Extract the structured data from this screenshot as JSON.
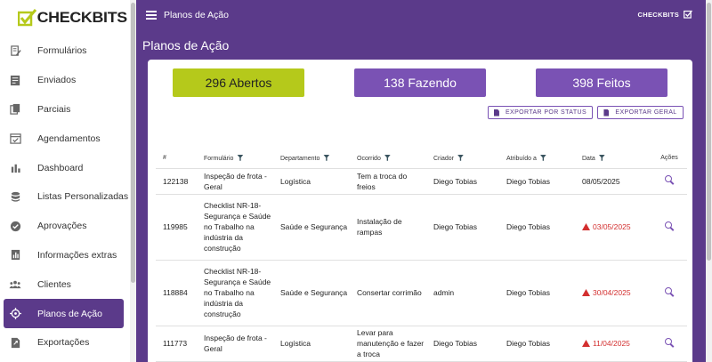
{
  "brand": {
    "name": "CHECKBITS",
    "accent": "#5b3a8a",
    "lime": "#b5c91b"
  },
  "sidebar": {
    "items": [
      {
        "label": "Formulários",
        "icon": "form-edit-icon"
      },
      {
        "label": "Enviados",
        "icon": "sent-list-icon"
      },
      {
        "label": "Parciais",
        "icon": "partial-docs-icon"
      },
      {
        "label": "Agendamentos",
        "icon": "calendar-check-icon"
      },
      {
        "label": "Dashboard",
        "icon": "bar-chart-icon"
      },
      {
        "label": "Listas Personalizadas",
        "icon": "database-icon"
      },
      {
        "label": "Aprovações",
        "icon": "approval-badge-icon"
      },
      {
        "label": "Informações extras",
        "icon": "info-doc-icon"
      },
      {
        "label": "Clientes",
        "icon": "users-icon"
      },
      {
        "label": "Planos de Ação",
        "icon": "crosshair-icon",
        "active": true
      },
      {
        "label": "Exportações",
        "icon": "export-file-icon"
      }
    ]
  },
  "topbar": {
    "title": "Planos de Ação",
    "right_label": "CHECKBITS"
  },
  "page": {
    "title": "Planos de Ação"
  },
  "stats": {
    "open": "296 Abertos",
    "doing": "138 Fazendo",
    "done": "398 Feitos"
  },
  "exports": {
    "status": "EXPORTAR POR STATUS",
    "geral": "EXPORTAR GERAL"
  },
  "table": {
    "headers": [
      "#",
      "Formulário",
      "Departamento",
      "Ocorrido",
      "Criador",
      "Atribuído a",
      "Data",
      "Ações"
    ],
    "rows": [
      {
        "id": "122138",
        "form": "Inspeção de frota - Geral",
        "dept": "Logística",
        "ocorrido": "Tem a troca do freios",
        "criador": "Diego Tobias",
        "atribuido": "Diego Tobias",
        "data": "08/05/2025",
        "late": false
      },
      {
        "id": "119985",
        "form": "Checklist NR-18- Segurança e Saúde no Trabalho na indústria da construção",
        "dept": "Saúde e Segurança",
        "ocorrido": "Instalação de rampas",
        "criador": "Diego Tobias",
        "atribuido": "Diego Tobias",
        "data": "03/05/2025",
        "late": true
      },
      {
        "id": "118884",
        "form": "Checklist NR-18- Segurança e Saúde no Trabalho na indústria da construção",
        "dept": "Saúde e Segurança",
        "ocorrido": "Consertar corrimão",
        "criador": "admin",
        "atribuido": "Diego Tobias",
        "data": "30/04/2025",
        "late": true
      },
      {
        "id": "111773",
        "form": "Inspeção de frota - Geral",
        "dept": "Logística",
        "ocorrido": "Levar para manutenção e fazer a troca",
        "criador": "Diego Tobias",
        "atribuido": "Diego Tobias",
        "data": "11/04/2025",
        "late": true
      }
    ]
  }
}
